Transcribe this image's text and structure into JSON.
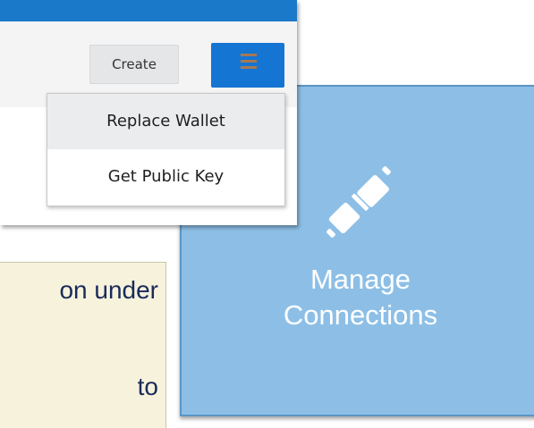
{
  "toolbar": {
    "create_label": "Create",
    "menu_icon": "hamburger-icon"
  },
  "dropdown": {
    "items": [
      {
        "label": "Replace Wallet"
      },
      {
        "label": "Get Public Key"
      }
    ]
  },
  "callout": {
    "lines": [
      "on under",
      "to"
    ]
  },
  "tile": {
    "icon": "plug-connection-icon",
    "label_line1": "Manage",
    "label_line2": "Connections"
  },
  "colors": {
    "topbar": "#1a79c9",
    "menu_button": "#1575d2",
    "tile_bg": "#8dbfe6",
    "callout_bg": "#f6f2dc",
    "callout_text": "#1a2a5a"
  }
}
